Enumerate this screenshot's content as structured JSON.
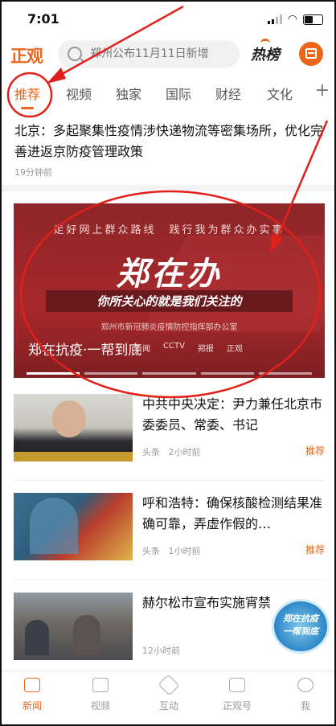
{
  "status": {
    "time": "7:01"
  },
  "header": {
    "logo": "正观",
    "search_placeholder": "郑州公布11月11日新增",
    "hot_label": "热榜"
  },
  "tabs": [
    {
      "label": "推荐",
      "active": true
    },
    {
      "label": "视频"
    },
    {
      "label": "独家"
    },
    {
      "label": "国际"
    },
    {
      "label": "财经"
    },
    {
      "label": "文化"
    }
  ],
  "tab_more": "+",
  "top_article": {
    "title": "北京：多起聚集性疫情涉快递物流等密集场所，优化完善进返京防疫管理政策",
    "time": "19分钟前"
  },
  "banner": {
    "tagline": "走好网上群众路线　践行我为群众办实事",
    "headline": "郑在办",
    "subline": "你所关心的就是我们关注的",
    "org": "郑州市新冠肺炎疫情防控指挥部办公室",
    "caption": "郑在抗疫·一帮到底",
    "logos": [
      "新闻",
      "CCTV",
      "郑报",
      "正观"
    ],
    "slide_count": 5,
    "active_slide": 0
  },
  "articles": [
    {
      "title": "中共中央决定：尹力兼任北京市委委员、常委、书记",
      "source": "头条",
      "time": "2小时前",
      "tag": "推荐"
    },
    {
      "title": "呼和浩特：确保核酸检测结果准确可靠，弄虚作假的…",
      "source": "头条",
      "time": "1小时前",
      "tag": "推荐"
    },
    {
      "title": "赫尔松市宣布实施宵禁",
      "source": "",
      "time": "12小时前",
      "tag": ""
    }
  ],
  "badge": {
    "line1": "郑在抗疫",
    "line2": "一帮到底"
  },
  "bottom_nav": [
    {
      "label": "新闻",
      "icon": "news-icon",
      "active": true
    },
    {
      "label": "视频",
      "icon": "video-icon"
    },
    {
      "label": "互动",
      "icon": "interact-icon"
    },
    {
      "label": "正观号",
      "icon": "account-icon"
    },
    {
      "label": "我",
      "icon": "profile-icon"
    }
  ],
  "colors": {
    "accent": "#e9661b",
    "annotation": "#e0201a",
    "banner": "#a7282b"
  }
}
